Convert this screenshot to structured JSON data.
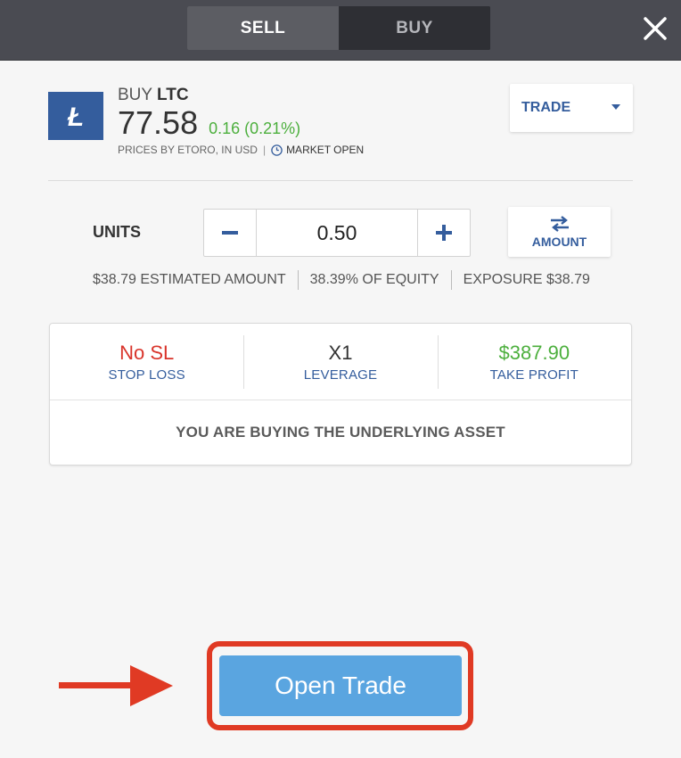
{
  "top_bar": {
    "sell_label": "SELL",
    "buy_label": "BUY",
    "active_side": "SELL"
  },
  "instrument": {
    "action": "BUY",
    "symbol": "LTC",
    "logo_glyph": "Ł",
    "logo_color": "#345d9d",
    "price": "77.58",
    "change": "0.16 (0.21%)",
    "price_source": "PRICES BY ETORO, IN USD",
    "separator": "|",
    "market_status": "MARKET OPEN"
  },
  "order_type": {
    "label": "TRADE"
  },
  "units": {
    "label": "UNITS",
    "value": "0.50",
    "toggle_label": "AMOUNT"
  },
  "stats": {
    "estimated_amount": "$38.79 ESTIMATED AMOUNT",
    "equity": "38.39% OF EQUITY",
    "exposure": "EXPOSURE $38.79"
  },
  "settings": {
    "stop_loss": {
      "value": "No SL",
      "label": "STOP LOSS"
    },
    "leverage": {
      "value": "X1",
      "label": "LEVERAGE"
    },
    "take_profit": {
      "value": "$387.90",
      "label": "TAKE PROFIT"
    },
    "note": "YOU ARE BUYING THE UNDERLYING ASSET"
  },
  "action": {
    "open_trade_label": "Open Trade"
  },
  "colors": {
    "accent_blue": "#345d9d",
    "positive_green": "#4caf3d",
    "negative_red": "#d9342b",
    "button_blue": "#5aa5e0",
    "highlight_red": "#e03a24"
  }
}
